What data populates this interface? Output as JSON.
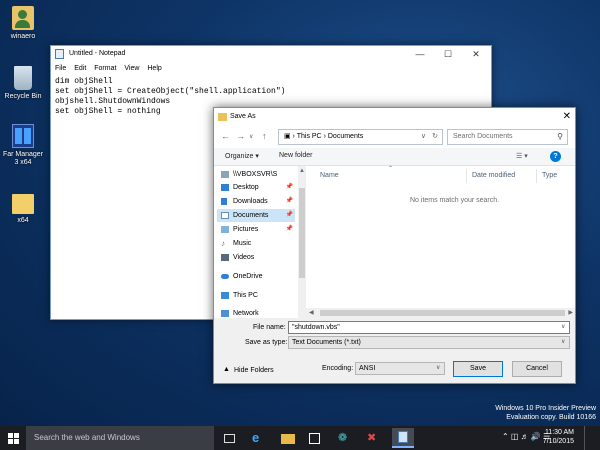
{
  "desktop": {
    "icons": [
      {
        "label": "winaero",
        "icon": "user-folder-icon"
      },
      {
        "label": "Recycle Bin",
        "icon": "recycle-bin-icon"
      },
      {
        "label_line1": "Far Manager",
        "label_line2": "3 x64",
        "icon": "far-manager-icon"
      },
      {
        "label": "x64",
        "icon": "folder-icon"
      }
    ]
  },
  "notepad": {
    "title": "Untitled - Notepad",
    "menu": [
      "File",
      "Edit",
      "Format",
      "View",
      "Help"
    ],
    "lines": [
      "dim objShell",
      "set objShell = CreateObject(\"shell.application\")",
      "objshell.ShutdownWindows",
      "set objShell = nothing"
    ]
  },
  "saveas": {
    "title": "Save As",
    "breadcrumb": {
      "root": "This PC",
      "child": "Documents"
    },
    "search_placeholder": "Search Documents",
    "toolbar": {
      "organize": "Organize ▾",
      "new_folder": "New folder"
    },
    "nav_items": [
      {
        "label": "\\\\VBOXSVR\\S",
        "icon": "network-drive-icon",
        "pinned": true
      },
      {
        "label": "Desktop",
        "icon": "desktop-icon",
        "pinned": true
      },
      {
        "label": "Downloads",
        "icon": "downloads-icon",
        "pinned": true
      },
      {
        "label": "Documents",
        "icon": "documents-icon",
        "pinned": true,
        "selected": true
      },
      {
        "label": "Pictures",
        "icon": "pictures-icon",
        "pinned": true
      },
      {
        "label": "Music",
        "icon": "music-icon"
      },
      {
        "label": "Videos",
        "icon": "videos-icon"
      },
      {
        "label": "OneDrive",
        "icon": "onedrive-icon"
      },
      {
        "label": "This PC",
        "icon": "this-pc-icon"
      },
      {
        "label": "Network",
        "icon": "network-icon"
      }
    ],
    "columns": [
      "Name",
      "Date modified",
      "Type"
    ],
    "empty_message": "No items match your search.",
    "file_name_label": "File name:",
    "file_name_value": "\"shutdown.vbs\"",
    "save_type_label": "Save as type:",
    "save_type_value": "Text Documents (*.txt)",
    "hide_folders": "Hide Folders",
    "encoding_label": "Encoding:",
    "encoding_value": "ANSI",
    "save_button": "Save",
    "cancel_button": "Cancel"
  },
  "taskbar": {
    "search_placeholder": "Search the web and Windows"
  },
  "watermark": {
    "line1": "Windows 10 Pro Insider Preview",
    "line2": "Evaluation copy. Build 10166"
  },
  "clock": {
    "time": "11:30 AM",
    "date": "7/10/2015"
  },
  "colors": {
    "accent": "#0078d7",
    "taskbar": "#1b1d23",
    "desktop": "#0e3466"
  }
}
